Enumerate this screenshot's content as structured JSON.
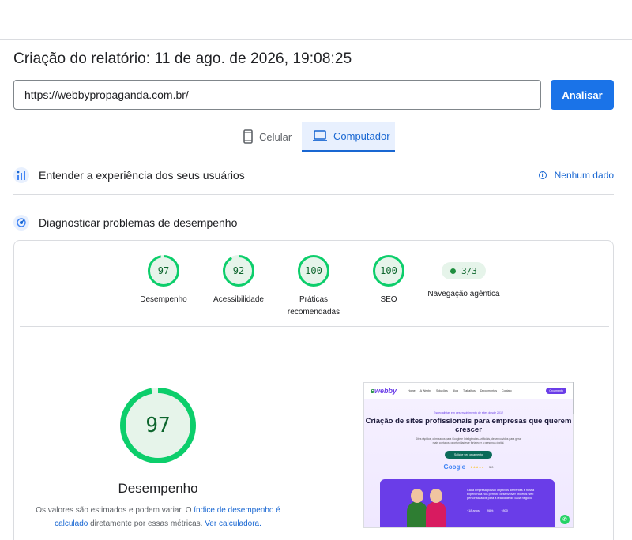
{
  "report": {
    "title": "Criação do relatório: 11 de ago. de 2026, 19:08:25"
  },
  "url_input": {
    "value": "https://webbypropaganda.com.br/"
  },
  "analyze_button": {
    "label": "Analisar"
  },
  "device_tabs": {
    "mobile": {
      "label": "Celular",
      "icon": "smartphone-icon"
    },
    "desktop": {
      "label": "Computador",
      "icon": "laptop-icon",
      "selected": true
    }
  },
  "sections": {
    "field_data": {
      "label": "Entender a experiência dos seus usuários",
      "icon": "users-chart-icon",
      "status": "Nenhum dado"
    },
    "lab_data": {
      "label": "Diagnosticar problemas de desempenho",
      "icon": "diagnostics-icon"
    }
  },
  "scores": [
    {
      "value": "97",
      "label": "Desempenho",
      "fraction": 0.97
    },
    {
      "value": "92",
      "label": "Acessibilidade",
      "fraction": 0.92
    },
    {
      "value": "100",
      "label": "Práticas recomendadas",
      "fraction": 1.0
    },
    {
      "value": "100",
      "label": "SEO",
      "fraction": 1.0
    }
  ],
  "agentic": {
    "value": "3/3",
    "label": "Navegação agêntica"
  },
  "performance": {
    "score": "97",
    "fraction": 0.97,
    "label": "Desempenho",
    "disclaimer_pre": "Os valores são estimados e podem variar. O ",
    "disclaimer_link1": "índice de desempenho é calculado",
    "disclaimer_mid": " diretamente por essas métricas. ",
    "disclaimer_link2": "Ver calculadora."
  },
  "thumbnail": {
    "logo": "webby",
    "nav_links": [
      "Home",
      "A Webby",
      "Soluções",
      "Blog",
      "Trabalhos",
      "Depoimentos",
      "Contato"
    ],
    "cta": "Orçamento",
    "eyebrow": "Especialistas em desenvolvimento de sites desde 2012",
    "headline": "Criação de sites profissionais para empresas que querem crescer",
    "subtext": "Sites rápidos, otimizados para Google e Inteligências Artificiais, desenvolvidos para gerar mais contatos, oportunidades e fortalecer a presença digital.",
    "button": "Solicite seu orçamento",
    "rating_brand": "Google",
    "rating_value": "5.0",
    "purple_text": "Cada empresa possui objetivos diferentes e nossa experiência nos permite desenvolver projetos web personalizados para a realidade de cada negócio",
    "stats": [
      "+18 anos",
      "98%",
      "+800"
    ]
  },
  "colors": {
    "accent": "#1a73e8",
    "pass": "#0cce6b",
    "pass_text": "#0d652d",
    "pass_bg": "#e6f4ea"
  }
}
